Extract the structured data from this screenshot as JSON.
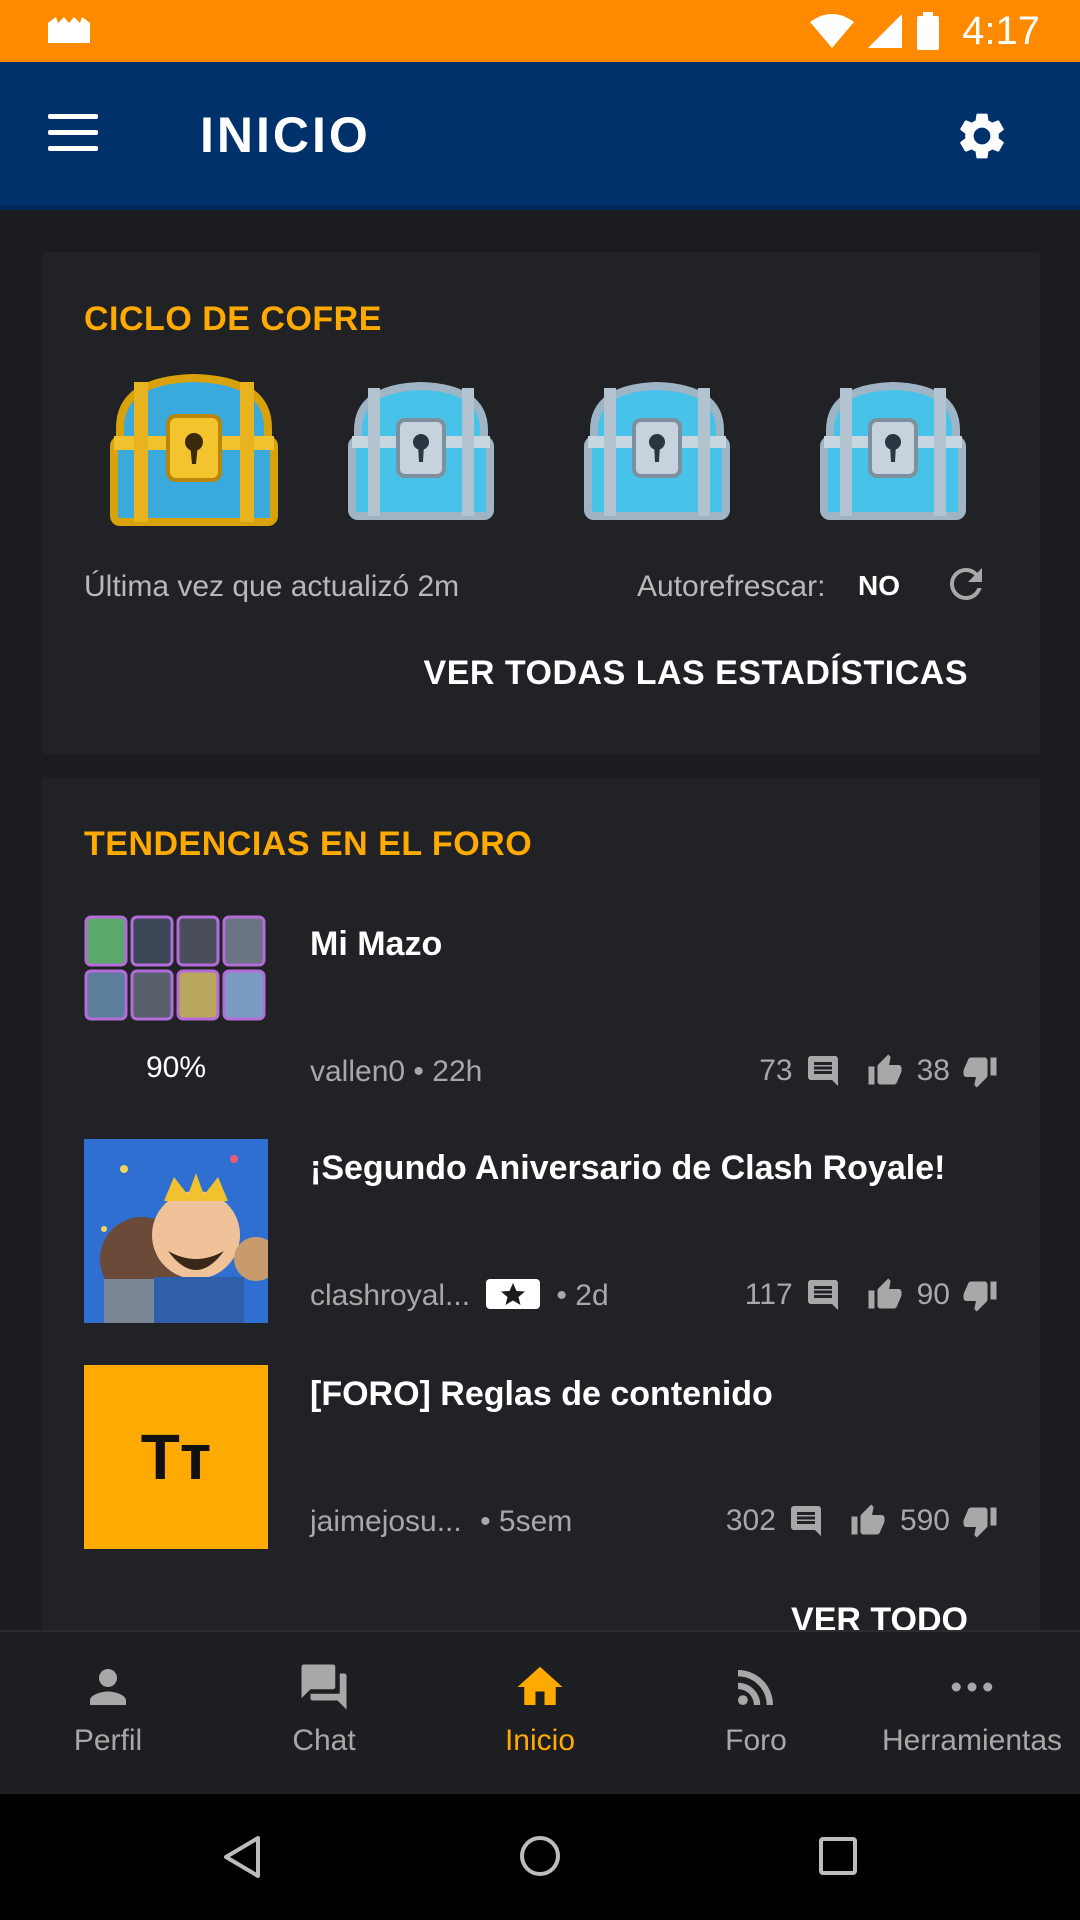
{
  "status_bar": {
    "time": "4:17",
    "accent": "#ff8a00"
  },
  "app_bar": {
    "title": "INICIO",
    "background": "#01316b"
  },
  "chest_card": {
    "title": "CICLO DE COFRE",
    "chests": [
      "gold-chest",
      "silver-chest",
      "silver-chest",
      "silver-chest"
    ],
    "updated_text": "Última vez que actualizó 2m",
    "autorefresh_label": "Autorefrescar:",
    "autorefresh_value": "NO",
    "stats_button": "VER TODAS LAS ESTADÍSTICAS"
  },
  "forum_card": {
    "title": "TENDENCIAS EN EL FORO",
    "posts": [
      {
        "title": "Mi Mazo",
        "author": "vallen0",
        "age": "• 22h",
        "comments": "73",
        "likes": "38",
        "deck_percent": "90%",
        "thumb": "deck-cards"
      },
      {
        "title": "¡Segundo Aniversario de Clash Royale!",
        "author": "clashroyal...",
        "age": "• 2d",
        "comments": "117",
        "likes": "90",
        "thumb": "anniversary-art"
      },
      {
        "title": "[FORO] Reglas de contenido",
        "author": "jaimejosu...",
        "age": "• 5sem",
        "comments": "302",
        "likes": "590",
        "thumb_text": "Tт"
      }
    ],
    "view_all": "VER TODO"
  },
  "bottom_nav": [
    {
      "label": "Perfil",
      "icon": "person-icon"
    },
    {
      "label": "Chat",
      "icon": "chat-icon"
    },
    {
      "label": "Inicio",
      "icon": "home-icon",
      "active": true
    },
    {
      "label": "Foro",
      "icon": "rss-icon"
    },
    {
      "label": "Herramientas",
      "icon": "more-icon"
    }
  ],
  "colors": {
    "accent": "#ffaa00",
    "card": "#202225",
    "background": "#1a1c20"
  }
}
